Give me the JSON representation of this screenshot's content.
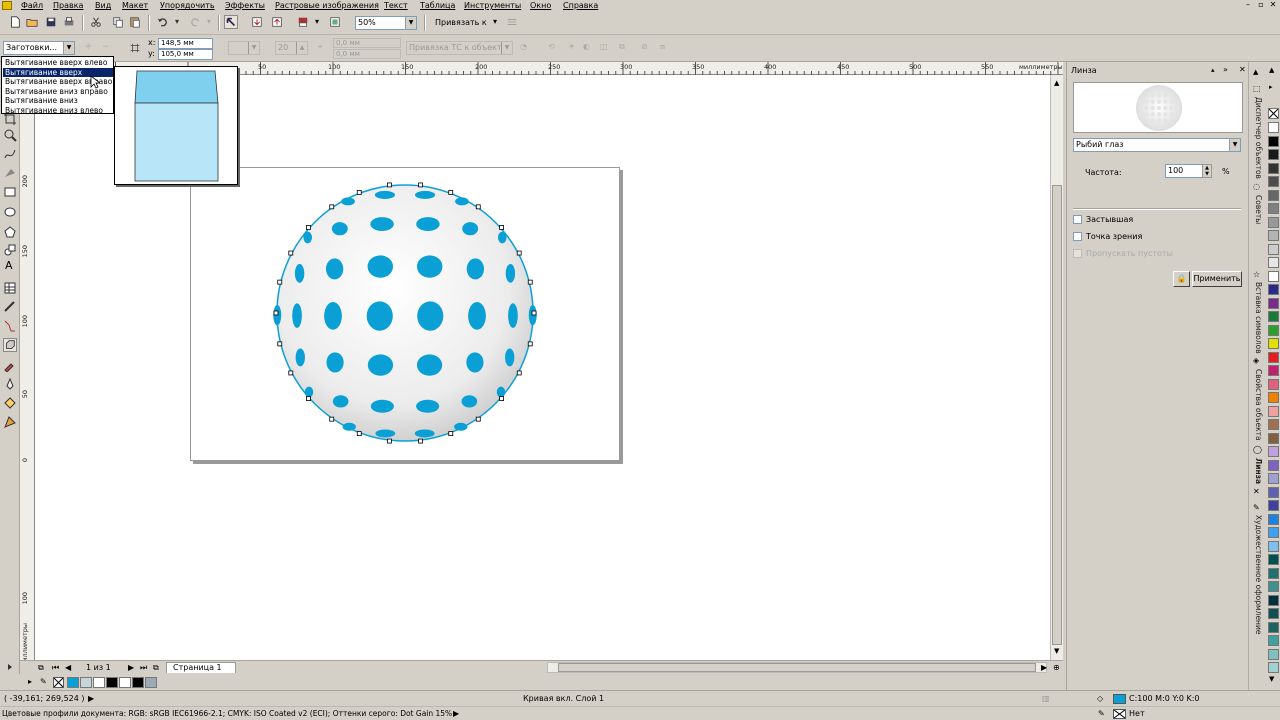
{
  "menu": [
    "Файл",
    "Правка",
    "Вид",
    "Макет",
    "Упорядочить",
    "Эффекты",
    "Растровые изображения",
    "Текст",
    "Таблица",
    "Инструменты",
    "Окно",
    "Справка"
  ],
  "window_controls": {
    "minimize": "–",
    "restore": "▫",
    "close": "✕"
  },
  "toolbar": {
    "zoom": "50%",
    "snap_label": "Привязать к"
  },
  "property_bar": {
    "presets": "Заготовки...",
    "x_label": "x:",
    "x_value": "148,5 мм",
    "y_label": "y:",
    "y_value": "105,0 мм",
    "depth_value": "20",
    "vp_x": "0,0 мм",
    "vp_y": "0,0 мм",
    "vp_lock": "Привязка ТС к объекту"
  },
  "preset_dropdown": {
    "items": [
      "Вытягивание вверх влево",
      "Вытягивание вверх",
      "Вытягивание вверх вправо",
      "Вытягивание вниз вправо",
      "Вытягивание вниз",
      "Вытягивание вниз влево"
    ],
    "selected_index": 1
  },
  "ruler": {
    "top_labels": [
      "50",
      "100",
      "150",
      "200",
      "250",
      "300",
      "350",
      "400",
      "450",
      "500",
      "550"
    ],
    "units": "миллиметры",
    "left_labels": [
      "200",
      "150",
      "100",
      "50",
      "0",
      "100"
    ],
    "left_units": "миллиметры"
  },
  "page_nav": {
    "count": "1 из 1",
    "tab": "Страница 1"
  },
  "status": {
    "coords": "( -39,161; 269,524 )",
    "object_info": "Кривая вкл. Слой 1",
    "fill_color": "C:100 M:0 Y:0 K:0",
    "outline": "Нет",
    "color_profiles": "Цветовые профили документа: RGB: sRGB IEC61966-2.1; CMYK: ISO Coated v2 (ECI); Оттенки серого: Dot Gain 15%"
  },
  "docker": {
    "title": "Линза",
    "lens_type": "Рыбий глаз",
    "rate_label": "Частота:",
    "rate_value": "100",
    "rate_unit": "%",
    "frozen_label": "Застывшая",
    "viewpoint_label": "Точка зрения",
    "remove_face_label": "Пропускать пустоты",
    "apply_label": "Применить"
  },
  "docker_tabs": [
    "Диспетчер объектов",
    "Советы",
    "Вставка символов",
    "Свойства объекта",
    "Линза",
    "Художественное оформление"
  ],
  "colors": {
    "accent_blue": "#0aa0d6",
    "selection": "#0a246a"
  },
  "palette_bottom": [
    "#0aa0d6",
    "#c8d4dc",
    "#ffffff",
    "#000000",
    "#ffffff",
    "#000000",
    "#9aaab6"
  ],
  "palette_right": [
    "#ffffff",
    "#000000",
    "#1a1a1a",
    "#333333",
    "#4d4d4d",
    "#666666",
    "#808080",
    "#999999",
    "#b3b3b3",
    "#cccccc",
    "#e6e6e6",
    "#ffffff",
    "#2a2a8a",
    "#7a2a8a",
    "#1a7a3a",
    "#2aa02a",
    "#e0e000",
    "#e02020",
    "#c02070",
    "#e06080",
    "#f08000",
    "#f0a0a0",
    "#a07050",
    "#806040",
    "#c0a0e0",
    "#8060c0",
    "#a0a0d0",
    "#6060b0",
    "#4040a0",
    "#2080e0",
    "#40a0f0",
    "#80c0f0",
    "#005050",
    "#207070",
    "#409090",
    "#003040",
    "#105050",
    "#206060",
    "#40a0a0",
    "#80c0c0",
    "#a0d0d0"
  ]
}
